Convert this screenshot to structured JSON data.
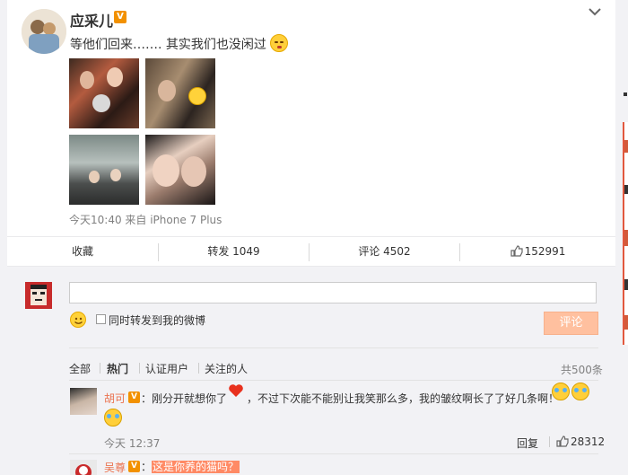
{
  "post": {
    "author": "应采儿",
    "verified_badge": "V",
    "text": "等他们回来……. 其实我们也没闲过",
    "emoji_icon": "kiss-face-icon",
    "time": "今天10:40 来自 iPhone 7 Plus",
    "photos": [
      "photo-1",
      "photo-2",
      "photo-3",
      "photo-4"
    ]
  },
  "actions": {
    "favorite": "收藏",
    "repost": "转发 1049",
    "comment": "评论 4502",
    "like_count": "152991"
  },
  "reply_box": {
    "placeholder": "",
    "repost_checkbox_label": "同时转发到我的微博",
    "submit_label": "评论"
  },
  "filters": {
    "all": "全部",
    "hot": "热门",
    "verified": "认证用户",
    "following": "关注的人",
    "total": "共500条"
  },
  "comments": [
    {
      "name": "胡可",
      "badge": "V",
      "text_a": "：刚分开就想你了",
      "text_b": "，不过下次能不能别让我笑那么多，我的皱纹啊长了了好几条啊！",
      "time": "今天 12:37",
      "reply": "回复",
      "likes": "28312"
    },
    {
      "name": "吴尊",
      "badge": "V",
      "colon": "：",
      "text": "这是你养的猫吗？"
    }
  ],
  "colors": {
    "accent": "#eb7350",
    "verified": "#f29100",
    "submit_disabled": "#ffc09f"
  }
}
